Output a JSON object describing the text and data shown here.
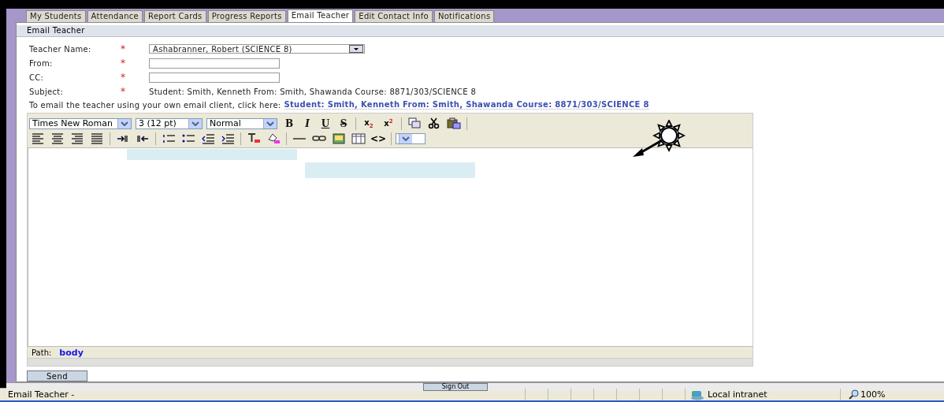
{
  "tabs": [
    {
      "label": "My Students",
      "selected": false
    },
    {
      "label": "Attendance",
      "selected": false
    },
    {
      "label": "Report Cards",
      "selected": false
    },
    {
      "label": "Progress Reports",
      "selected": false
    },
    {
      "label": "Email Teacher",
      "selected": true
    },
    {
      "label": "Edit Contact Info",
      "selected": false
    },
    {
      "label": "Notifications",
      "selected": false
    }
  ],
  "panel": {
    "title": "Email Teacher"
  },
  "form": {
    "fields": [
      {
        "kind": "select",
        "label": "Teacher Name:",
        "required_mark": "*",
        "value": "Ashabranner, Robert (SCIENCE 8)"
      },
      {
        "kind": "input",
        "label": "From:",
        "required_mark": "*"
      },
      {
        "kind": "input",
        "label": "CC:",
        "required_mark": "*"
      },
      {
        "kind": "text",
        "label": "Subject:",
        "required_mark": "*",
        "value": "Student: Smith, Kenneth From: Smith, Shawanda Course: 8871/303/SCIENCE 8"
      }
    ],
    "email_note": "To email the teacher using your own email client, click here:",
    "email_link": "Student: Smith, Kenneth From: Smith, Shawanda Course: 8871/303/SCIENCE 8"
  },
  "editor": {
    "toolbar_rows": [
      [
        {
          "kind": "select",
          "value": "Times New Roman"
        },
        {
          "kind": "select",
          "value": "3 (12 pt)"
        },
        {
          "kind": "select",
          "value": "Normal"
        },
        {
          "kind": "bold",
          "label": "B"
        },
        {
          "kind": "italic",
          "label": "I"
        },
        {
          "kind": "underline",
          "label": "U"
        },
        {
          "kind": "strike",
          "label": "S"
        },
        {
          "kind": "sep"
        },
        {
          "kind": "script",
          "label": "x$_{2}$"
        },
        {
          "kind": "script",
          "label": "x$^{2}$"
        },
        {
          "kind": "sep"
        },
        {
          "kind": "copy"
        },
        {
          "kind": "cut"
        },
        {
          "kind": "paste"
        },
        {
          "kind": "sep"
        }
      ],
      [
        {
          "kind": "align-left"
        },
        {
          "kind": "align-center"
        },
        {
          "kind": "align-right"
        },
        {
          "kind": "align-justify"
        },
        {
          "kind": "sep"
        },
        {
          "kind": "ltr"
        },
        {
          "kind": "rtl"
        },
        {
          "kind": "sep"
        },
        {
          "kind": "ordered-list"
        },
        {
          "kind": "bullet-list"
        },
        {
          "kind": "outdent"
        },
        {
          "kind": "indent"
        },
        {
          "kind": "sep"
        },
        {
          "kind": "text-color"
        },
        {
          "kind": "highlight"
        },
        {
          "kind": "sep"
        },
        {
          "kind": "rule"
        },
        {
          "kind": "link"
        },
        {
          "kind": "image"
        },
        {
          "kind": "table"
        },
        {
          "kind": "code",
          "label": "<>"
        },
        {
          "kind": "sep"
        },
        {
          "kind": "select"
        }
      ]
    ],
    "path_label": "Path:",
    "path_value": "body"
  },
  "send_button": "Send",
  "sign_out_button": "Sign Out",
  "status_bar": {
    "text": "Email Teacher -",
    "zone": "Local intranet",
    "zoom": "100%"
  }
}
